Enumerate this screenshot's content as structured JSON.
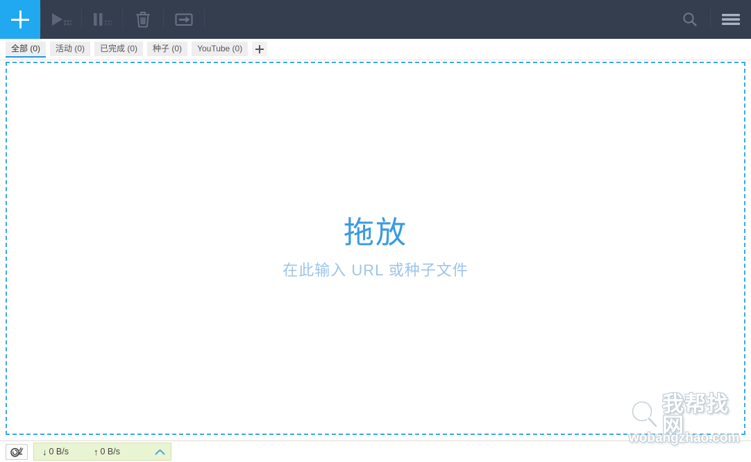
{
  "toolbar": {
    "add_label": "+",
    "add_icon": "plus-icon",
    "buttons": [
      {
        "name": "start-all-button",
        "icon": "play-all-icon",
        "title": "开始全部"
      },
      {
        "name": "pause-all-button",
        "icon": "pause-all-icon",
        "title": "暂停全部"
      },
      {
        "name": "delete-button",
        "icon": "trash-icon",
        "title": "删除"
      },
      {
        "name": "move-button",
        "icon": "move-folder-icon",
        "title": "移动"
      }
    ],
    "search_icon": "search-icon",
    "menu_icon": "hamburger-menu-icon",
    "background_color": "#343e4f",
    "accent_color": "#20a8f0"
  },
  "tabs": {
    "items": [
      {
        "label": "全部 (0)",
        "active": true
      },
      {
        "label": "活动 (0)",
        "active": false
      },
      {
        "label": "已完成 (0)",
        "active": false
      },
      {
        "label": "种子 (0)",
        "active": false
      },
      {
        "label": "YouTube (0)",
        "active": false
      }
    ],
    "add_tab_icon": "plus-icon",
    "active_underline_color": "#2196e8"
  },
  "dropzone": {
    "title": "拖放",
    "subtitle": "在此输入 URL 或种子文件",
    "border_color": "#3aa8e8",
    "title_color": "#3b9ae0",
    "subtitle_color": "#9dc5e8"
  },
  "statusbar": {
    "speed_limit_icon": "snail-icon",
    "download": {
      "icon": "arrow-down-icon",
      "arrow": "↓",
      "value": "0 B/s"
    },
    "upload": {
      "icon": "arrow-up-icon",
      "arrow": "↑",
      "value": "0 B/s"
    },
    "expand_icon": "chevron-up-icon",
    "panel_color": "#e9f5d2"
  },
  "watermark": {
    "icon": "magnifier-icon",
    "text_cn": "我帮找网",
    "text_en": "wobangzhao.com"
  }
}
